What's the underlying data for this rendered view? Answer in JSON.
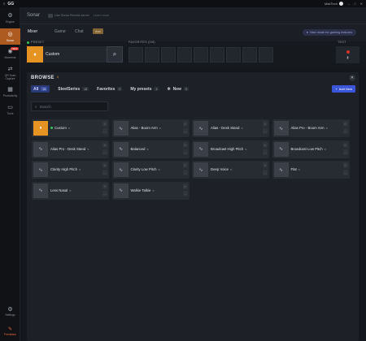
{
  "titlebar": {
    "app": "GG",
    "user": "MakTech"
  },
  "sidebar": {
    "items": [
      {
        "label": "Engine",
        "icon": "engine-icon"
      },
      {
        "label": "Sonar",
        "icon": "sonar-icon",
        "active": true
      },
      {
        "label": "Moments",
        "icon": "moments-icon",
        "badge": "NEW"
      },
      {
        "label": "QR Scan Capture",
        "icon": "qr-icon"
      },
      {
        "label": "Productivity",
        "icon": "productivity-icon"
      },
      {
        "label": "Tools",
        "icon": "tools-icon"
      }
    ],
    "settings": "Settings",
    "feedback": "Feedback"
  },
  "header": {
    "title": "Sonar",
    "subtitle": "Use Sonar Record server",
    "learn": "Learn more"
  },
  "tabs": {
    "items": [
      "Mixer",
      "Game",
      "Chat"
    ],
    "aux": "Aux",
    "new_mode": "New mode for gaming features"
  },
  "preset": {
    "label": "PRESET",
    "name": "Custom",
    "favorites_label": "FAVORITES (0/8)",
    "test_label": "TEST"
  },
  "browse": {
    "title": "BROWSE",
    "tabs": [
      {
        "label": "All",
        "count": "18",
        "active": true
      },
      {
        "label": "SteelSeries",
        "count": "18"
      },
      {
        "label": "Favorites",
        "count": "0"
      },
      {
        "label": "My presets",
        "count": "1"
      },
      {
        "label": "New",
        "count": "0"
      }
    ],
    "add_new": "Add New",
    "search_placeholder": "Search",
    "cards": [
      {
        "name": "Custom",
        "active": true
      },
      {
        "name": "Alias - Boom Arm"
      },
      {
        "name": "Alias - Desk Stand"
      },
      {
        "name": "Alias Pro - Boom Arm"
      },
      {
        "name": "Alias Pro - Desk Stand"
      },
      {
        "name": "Balanced"
      },
      {
        "name": "Broadcast High Pitch"
      },
      {
        "name": "Broadcast Low Pitch"
      },
      {
        "name": "Clarity High Pitch"
      },
      {
        "name": "Clarity Low Pitch"
      },
      {
        "name": "Deep Voice"
      },
      {
        "name": "Flat"
      },
      {
        "name": "Less Nasal"
      },
      {
        "name": "Walkie Talkie"
      }
    ]
  }
}
